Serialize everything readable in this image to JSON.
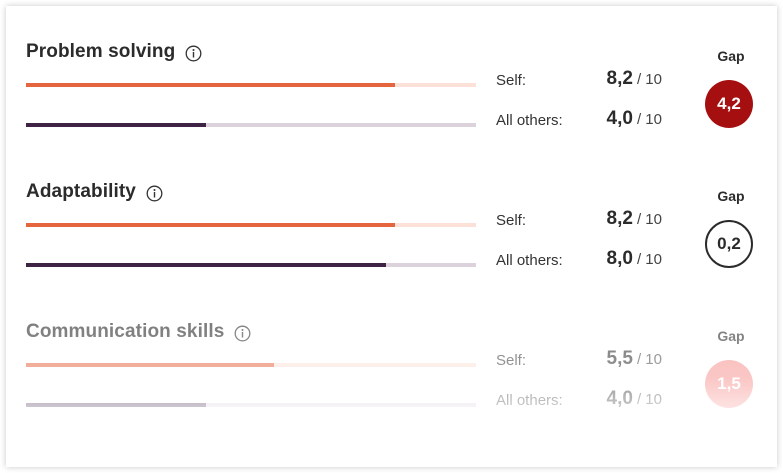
{
  "colors": {
    "self_fill": "#e5653e",
    "self_track": "#fbe1d8",
    "others_fill": "#3f2344",
    "others_track": "#dbd2dc",
    "gap_high": "#a60f10",
    "gap_mid": "#f58f8c"
  },
  "icons": {
    "info": "info-circle-icon"
  },
  "labels": {
    "self": "Self:",
    "others": "All others:",
    "gap": "Gap",
    "max": "/ 10"
  },
  "skills": [
    {
      "title": "Problem solving",
      "self_score": "8,2",
      "others_score": "4,0",
      "self_value": 8.2,
      "others_value": 4.0,
      "gap": "4,2",
      "gap_level": "high"
    },
    {
      "title": "Adaptability",
      "self_score": "8,2",
      "others_score": "8,0",
      "self_value": 8.2,
      "others_value": 8.0,
      "gap": "0,2",
      "gap_level": "low"
    },
    {
      "title": "Communication skills",
      "self_score": "5,5",
      "others_score": "4,0",
      "self_value": 5.5,
      "others_value": 4.0,
      "gap": "1,5",
      "gap_level": "mid"
    }
  ]
}
